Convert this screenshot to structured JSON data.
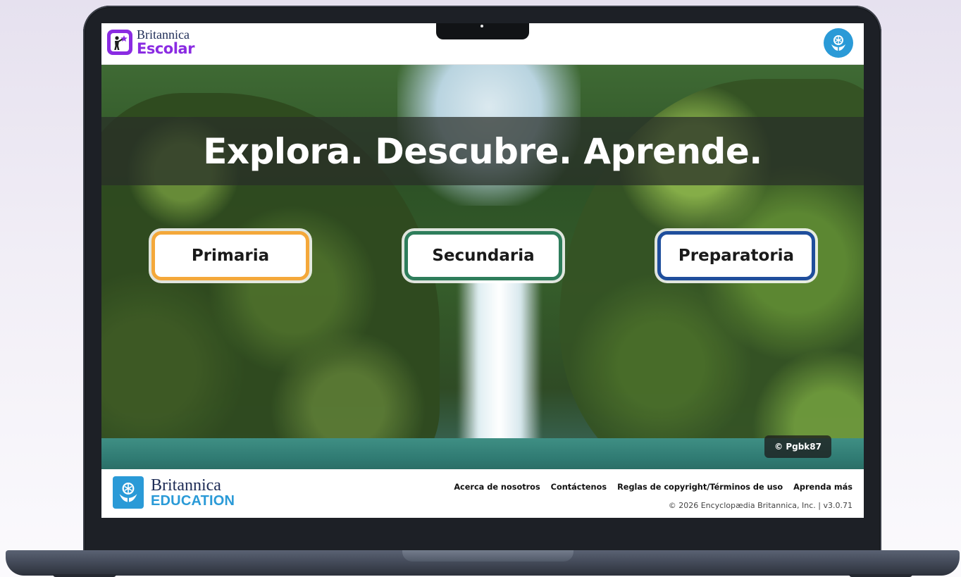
{
  "header": {
    "logo_line1": "Britannica",
    "logo_line2": "Escolar"
  },
  "hero": {
    "headline": "Explora. Descubre. Aprende.",
    "levels": [
      {
        "label": "Primaria",
        "color": "#f4a83a"
      },
      {
        "label": "Secundaria",
        "color": "#2e7d5b"
      },
      {
        "label": "Preparatoria",
        "color": "#1f4e9c"
      }
    ],
    "photo_credit": "© Pgbk87"
  },
  "footer": {
    "logo_line1": "Britannica",
    "logo_line2": "EDUCATION",
    "links": [
      "Acerca de nosotros",
      "Contáctenos",
      "Reglas de copyright/Términos de uso",
      "Aprenda más"
    ],
    "copyright": "© 2026 Encyclopædia Britannica, Inc. | v3.0.71"
  },
  "colors": {
    "escolar_purple": "#8a2be2",
    "britannica_blue": "#2a9ad7",
    "navy": "#1d2b55"
  },
  "icons": {
    "escolar_logo": "student-star-icon",
    "corner": "britannica-thistle-icon",
    "footer_logo": "britannica-thistle-icon"
  }
}
